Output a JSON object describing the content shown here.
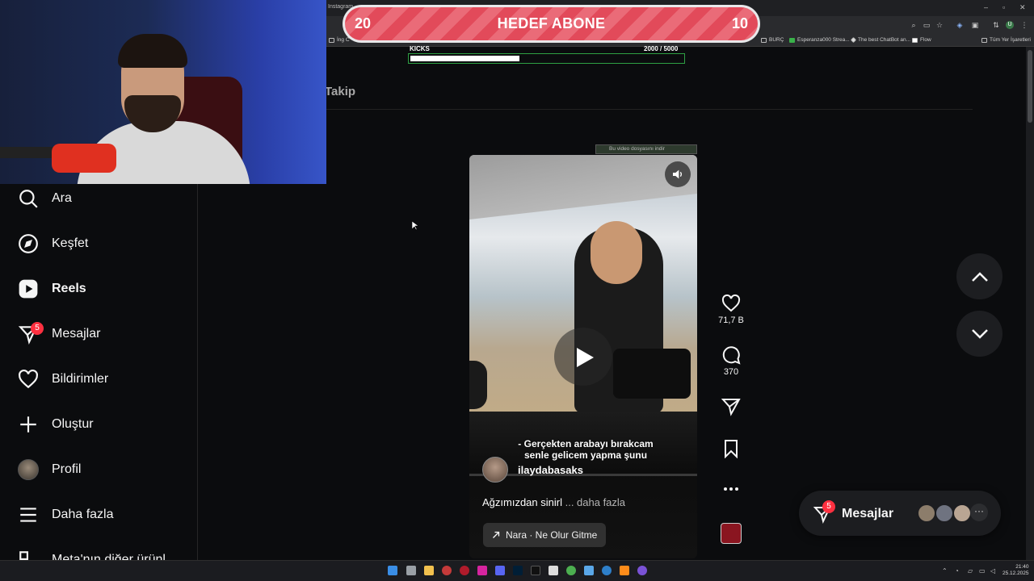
{
  "browser": {
    "tab_title": "Instagram",
    "bookmarks": [
      "İng C",
      "BURÇ",
      "Esperanza000 Strea...",
      "The best ChatBot an...",
      "Flow",
      "Tüm Yer İşaretleri"
    ]
  },
  "overlay": {
    "goal_left": "20",
    "goal_title": "HEDEF ABONE",
    "goal_right": "10",
    "kicks_label": "KICKS",
    "kicks_count": "2000  / 5000",
    "kicks_progress": 0.4
  },
  "header": {
    "following_tab": "Takip"
  },
  "sidebar": {
    "items": [
      {
        "label": "Ara",
        "icon": "search-icon"
      },
      {
        "label": "Keşfet",
        "icon": "compass-icon"
      },
      {
        "label": "Reels",
        "icon": "reels-icon"
      },
      {
        "label": "Mesajlar",
        "icon": "messenger-icon",
        "badge": "5"
      },
      {
        "label": "Bildirimler",
        "icon": "heart-icon"
      },
      {
        "label": "Oluştur",
        "icon": "plus-icon"
      },
      {
        "label": "Profil",
        "icon": "avatar"
      },
      {
        "label": "Daha fazla",
        "icon": "menu-icon"
      },
      {
        "label": "Meta'nın diğer ürünl...",
        "icon": "meta-icon"
      }
    ]
  },
  "reel": {
    "video_note": "Bu video dosyasını indir",
    "caption": "- Gerçekten arabayı bırakcam\nsenle gelicem yapma şunu",
    "username": "ilaydabasaks",
    "description": "Ağzımızdan sinirl",
    "more": " ... daha fazla",
    "music": "Nara · Ne Olur Gitme",
    "likes": "71,7 B",
    "comments": "370"
  },
  "messages_pill": {
    "label": "Mesajlar",
    "badge": "5",
    "more": "···"
  },
  "taskbar": {
    "time": "21:40",
    "date": "25.12.2025"
  },
  "colors": {
    "accent_red": "#ff3040",
    "goal_pink": "#e24a5a",
    "kicks_green": "#2ea043"
  }
}
